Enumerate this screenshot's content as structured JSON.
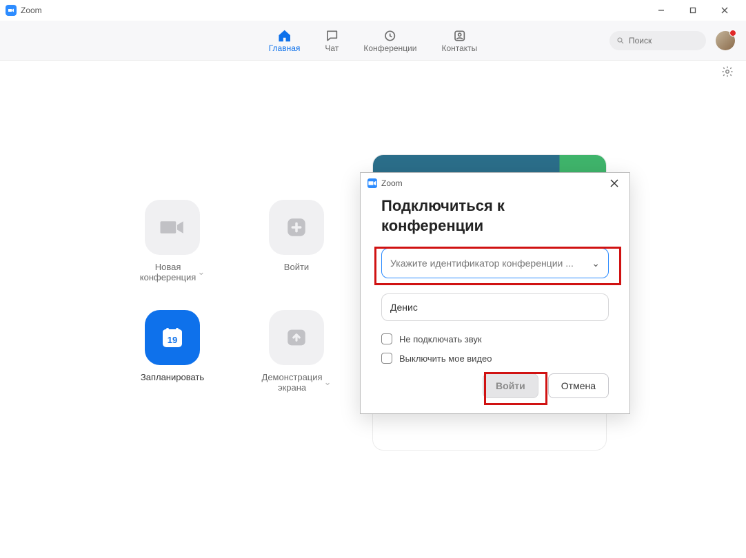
{
  "window": {
    "title": "Zoom"
  },
  "nav": {
    "items": [
      {
        "label": "Главная"
      },
      {
        "label": "Чат"
      },
      {
        "label": "Конференции"
      },
      {
        "label": "Контакты"
      }
    ]
  },
  "search": {
    "placeholder": "Поиск"
  },
  "tiles": {
    "new_meeting": {
      "line1": "Новая",
      "line2": "конференция"
    },
    "join": {
      "label": "Войти"
    },
    "schedule": {
      "label": "Запланировать",
      "day": "19"
    },
    "share": {
      "line1": "Демонстрация",
      "line2": "экрана"
    }
  },
  "dialog": {
    "title": "Zoom",
    "heading": "Подключиться к конференции",
    "meeting_id_placeholder": "Укажите идентификатор конференции ...",
    "name_value": "Денис",
    "opt_mute_audio": "Не подключать звук",
    "opt_disable_video": "Выключить мое видео",
    "join_label": "Войти",
    "cancel_label": "Отмена"
  }
}
